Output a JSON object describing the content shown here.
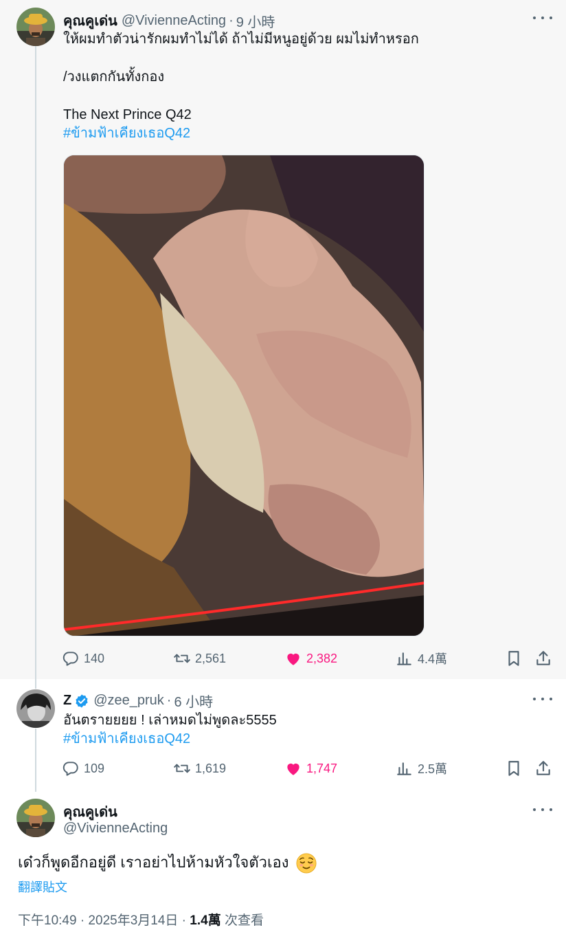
{
  "tweet1": {
    "display_name": "คุณคูเด่น",
    "handle": "@VivienneActing",
    "dot": "·",
    "time": "9 小時",
    "lines": [
      "ให้ผมทำตัวน่ารักผมทำไม่ได้ ถ้าไม่มีหนูอยู่ด้วย ผมไม่ทำหรอก",
      "/วงแตกกันทั้งกอง",
      "The Next Prince Q42"
    ],
    "hashtag": "#ข้ามฟ้าเคียงเธอQ42",
    "stats": {
      "replies": "140",
      "reposts": "2,561",
      "likes": "2,382",
      "views": "4.4萬"
    }
  },
  "tweet2": {
    "display_name": "Z",
    "handle": "@zee_pruk",
    "dot": "·",
    "time": "6 小時",
    "text": "อันตรายยยย ! เล่าหมดไม่พูดละ5555",
    "hashtag": "#ข้ามฟ้าเคียงเธอQ42",
    "stats": {
      "replies": "109",
      "reposts": "1,619",
      "likes": "1,747",
      "views": "2.5萬"
    }
  },
  "tweet3": {
    "display_name": "คุณคูเด่น",
    "handle": "@VivienneActing",
    "text": "เด๋วก็พูดอีกอยู่ดี เราอย่าไปห้ามหัวใจตัวเอง",
    "emoji": "relieved-face-icon",
    "translate": "翻譯貼文",
    "timestamp": "下午10:49 · 2025年3月14日 ·",
    "views_count": "1.4萬",
    "views_label": "次查看"
  },
  "colors": {
    "link": "#1d9bf0",
    "like": "#f91880",
    "muted": "#536471",
    "verified": "#1d9bf0"
  }
}
